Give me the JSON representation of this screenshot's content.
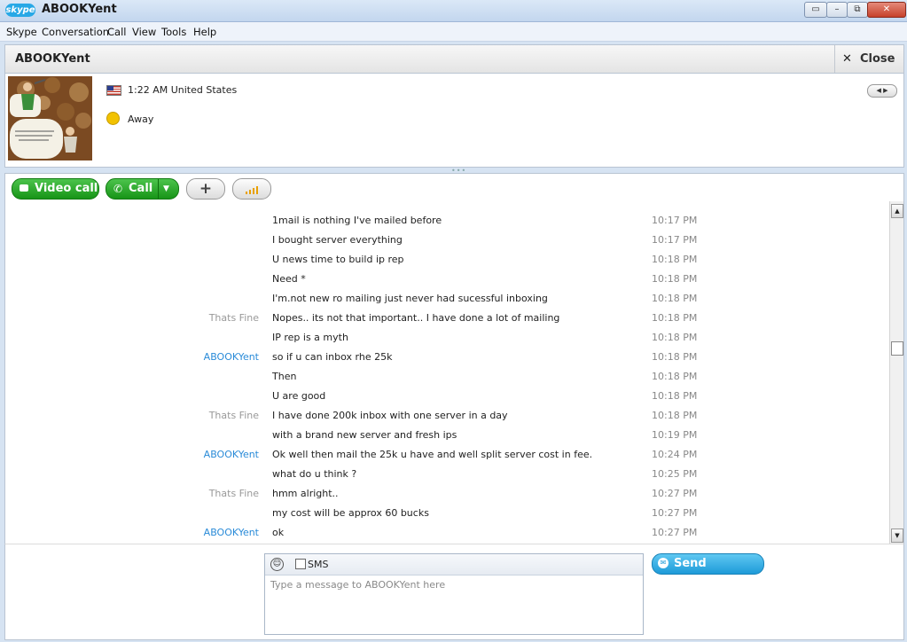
{
  "app": {
    "logo": "skype",
    "window_title": "ABOOKYent"
  },
  "window_buttons": {
    "minimize": "▭",
    "restore": "⧉",
    "maximize": "□",
    "close": "✕"
  },
  "menu": [
    "Skype",
    "Conversation",
    "Call",
    "View",
    "Tools",
    "Help"
  ],
  "conversation": {
    "title": "ABOOKYent",
    "close_label": "Close",
    "close_icon": "close-icon"
  },
  "profile": {
    "time_country": "1:22 AM United States",
    "status": "Away",
    "status_color": "#f2c200"
  },
  "toolbar": {
    "video_call": "Video call",
    "call": "Call",
    "add": "+",
    "quality_icon": "call-quality-icon"
  },
  "colors": {
    "accent_green": "#2aab2a",
    "accent_blue": "#27a8e6",
    "sender_link": "#2a8bd8"
  },
  "messages": [
    {
      "sender": "",
      "body": "1mail is nothing I've mailed before",
      "time": "10:17 PM"
    },
    {
      "sender": "",
      "body": "I bought server everything",
      "time": "10:17 PM"
    },
    {
      "sender": "",
      "body": "U news time to build ip rep",
      "time": "10:18 PM"
    },
    {
      "sender": "",
      "body": "Need *",
      "time": "10:18 PM"
    },
    {
      "sender": "",
      "body": "I'm.not new ro mailing just never had sucessful inboxing",
      "time": "10:18 PM"
    },
    {
      "sender": "Thats Fine",
      "body": "Nopes.. its not that important.. I have done a lot of mailing",
      "time": "10:18 PM"
    },
    {
      "sender": "",
      "body": "IP rep is a myth",
      "time": "10:18 PM"
    },
    {
      "sender": "ABOOKYent",
      "body": "so if u can inbox rhe 25k",
      "time": "10:18 PM"
    },
    {
      "sender": "",
      "body": "Then",
      "time": "10:18 PM"
    },
    {
      "sender": "",
      "body": "U are good",
      "time": "10:18 PM"
    },
    {
      "sender": "Thats Fine",
      "body": "I have done 200k inbox with one server in a day",
      "time": "10:18 PM"
    },
    {
      "sender": "",
      "body": "with a brand new server and fresh ips",
      "time": "10:19 PM"
    },
    {
      "sender": "ABOOKYent",
      "body": "Ok well then mail the 25k u have and well split server cost in fee.",
      "time": "10:24 PM"
    },
    {
      "sender": "",
      "body": "what do u think ?",
      "time": "10:25 PM"
    },
    {
      "sender": "Thats Fine",
      "body": "hmm alright..",
      "time": "10:27 PM"
    },
    {
      "sender": "",
      "body": "my cost will be approx 60 bucks",
      "time": "10:27 PM"
    },
    {
      "sender": "ABOOKYent",
      "body": "ok",
      "time": "10:27 PM"
    }
  ],
  "input": {
    "sms_label": "SMS",
    "placeholder": "Type a message to ABOOKYent here",
    "value": ""
  },
  "send": {
    "label": "Send message"
  }
}
